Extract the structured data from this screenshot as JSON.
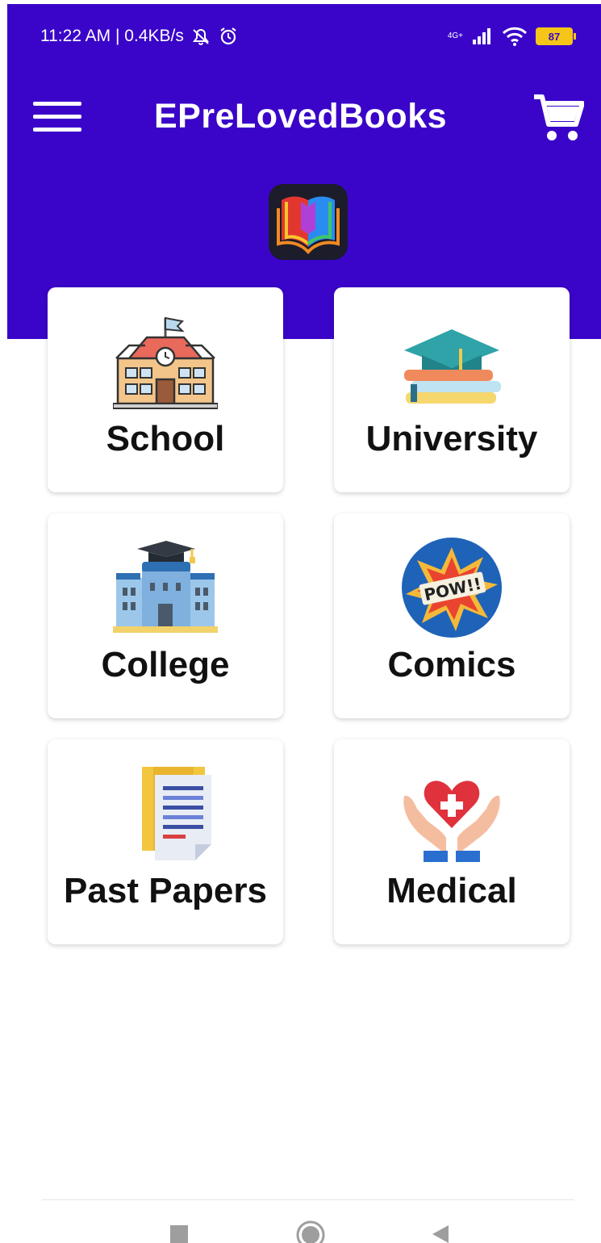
{
  "status_bar": {
    "time": "11:22 AM | 0.4KB/s",
    "network_label": "4G+",
    "battery": "87"
  },
  "app_bar": {
    "title": "EPreLovedBooks",
    "menu_icon": "hamburger-menu-icon",
    "cart_icon": "shopping-cart-icon"
  },
  "categories": [
    {
      "label": "School",
      "icon": "school-building-icon"
    },
    {
      "label": "University",
      "icon": "graduation-cap-books-icon"
    },
    {
      "label": "College",
      "icon": "college-building-icon"
    },
    {
      "label": "Comics",
      "icon": "comics-pow-icon"
    },
    {
      "label": "Past Papers",
      "icon": "past-papers-document-icon"
    },
    {
      "label": "Medical",
      "icon": "medical-heart-hands-icon"
    }
  ],
  "colors": {
    "header": "#3a05c8",
    "card_background": "#ffffff",
    "label_text": "#111111"
  }
}
